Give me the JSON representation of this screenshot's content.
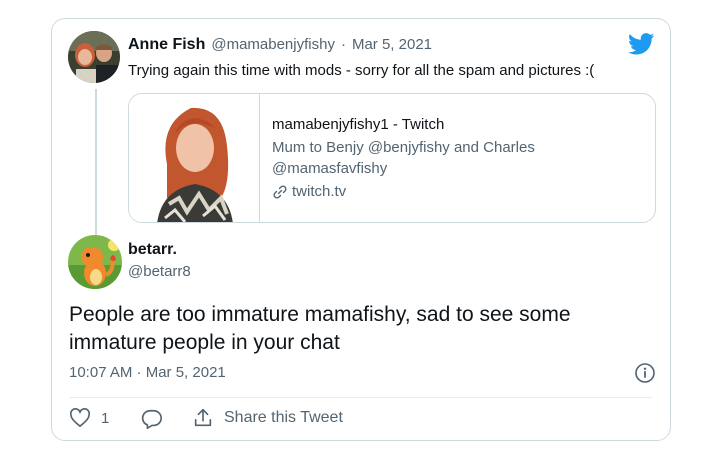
{
  "quoted_tweet": {
    "author_name": "Anne Fish",
    "author_handle": "@mamabenjyfishy",
    "separator": "·",
    "date": "Mar 5, 2021",
    "text": "Trying again this time with mods - sorry for all the spam and pictures :(",
    "link_card": {
      "title": "mamabenjyfishy1 - Twitch",
      "description_line1": "Mum to Benjy @benjyfishy and Charles",
      "description_line2": "@mamasfavfishy",
      "domain": "twitch.tv"
    }
  },
  "reply": {
    "author_name": "betarr.",
    "author_handle": "@betarr8",
    "text_line1": "People are too immature mamafishy, sad to see some",
    "text_line2": "immature people in your chat",
    "timestamp": "10:07 AM · Mar 5, 2021"
  },
  "actions": {
    "like_count": "1",
    "share_label": "Share this Tweet"
  },
  "colors": {
    "twitter_blue": "#1d9bf0",
    "muted_text": "#536471",
    "border": "#cfd9de"
  },
  "icons": [
    "twitter-bird-icon",
    "link-icon",
    "info-icon",
    "heart-icon",
    "reply-icon",
    "share-icon"
  ]
}
